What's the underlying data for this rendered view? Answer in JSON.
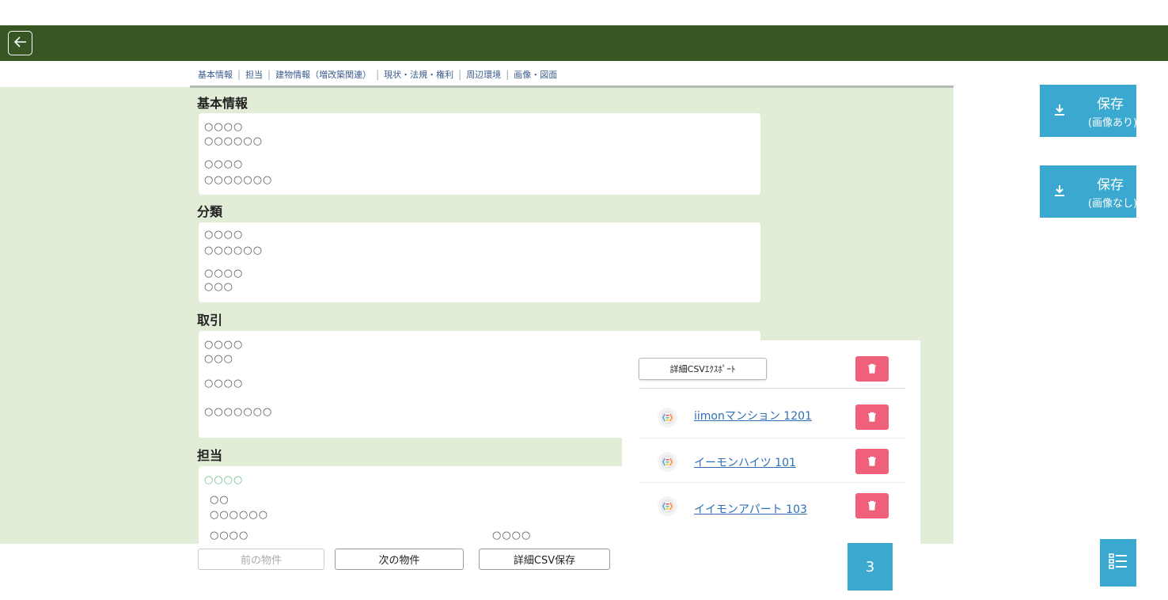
{
  "tabs": [
    "基本情報",
    "担当",
    "建物情報（増改築関連）",
    "現状・法規・権利",
    "周辺環境",
    "画像・図面"
  ],
  "sections": {
    "basic": {
      "title": "基本情報",
      "lines": [
        "○○○○",
        "○○○○○○",
        "○○○○",
        "○○○○○○○"
      ]
    },
    "category": {
      "title": "分類",
      "lines": [
        "○○○○",
        "○○○○○○",
        "○○○○",
        "○○○"
      ]
    },
    "deal": {
      "title": "取引",
      "lines": [
        "○○○○",
        "○○○",
        "○○○○",
        "○○○○○○○"
      ]
    },
    "staff": {
      "title": "担当",
      "lines": [
        "○○○○",
        "○○",
        "○○○○○○",
        "○○○○",
        "○○○○"
      ]
    }
  },
  "popup": {
    "export_label": "詳細CSVｴｸｽﾎﾟｰﾄ",
    "properties": [
      {
        "name": "iimonマンション 1201"
      },
      {
        "name": "イーモンハイツ 101"
      },
      {
        "name": "イイモンアパート 103"
      }
    ]
  },
  "bottom": {
    "prev_label": "前の物件",
    "next_label": "次の物件",
    "csv_save_label": "詳細CSV保存",
    "count": "3"
  },
  "save": {
    "with_images": {
      "title": "保存",
      "sub": "(画像あり)"
    },
    "without_images": {
      "title": "保存",
      "sub": "(画像なし)"
    }
  },
  "colors": {
    "topbar": "#375623",
    "content_bg": "#e1edd7",
    "accent": "#3aa8cf",
    "delete": "#f0607a",
    "link": "#2e6fb5"
  },
  "icons": {
    "back": "arrow-left-icon",
    "download": "download-icon",
    "trash": "trash-icon",
    "list": "list-icon",
    "property": "property-logo-icon"
  }
}
